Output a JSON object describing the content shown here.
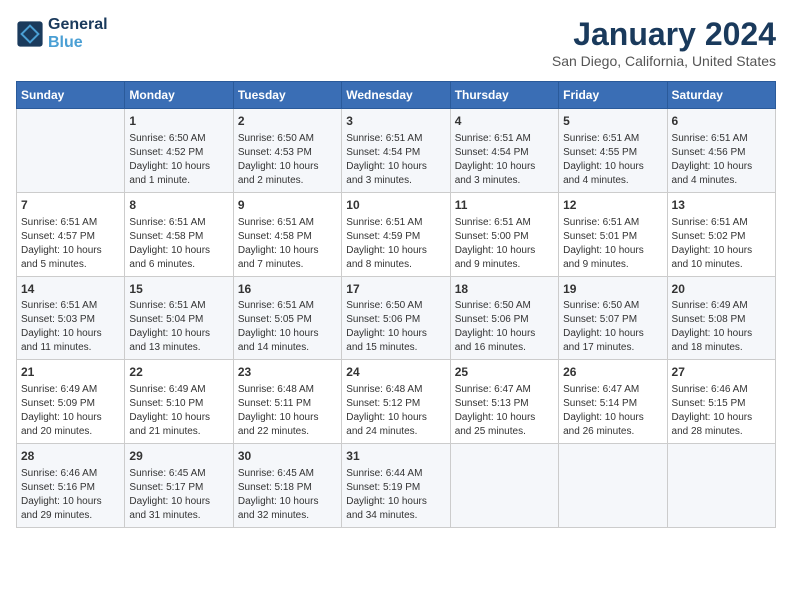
{
  "header": {
    "logo_line1": "General",
    "logo_line2": "Blue",
    "month_title": "January 2024",
    "subtitle": "San Diego, California, United States"
  },
  "calendar": {
    "days_of_week": [
      "Sunday",
      "Monday",
      "Tuesday",
      "Wednesday",
      "Thursday",
      "Friday",
      "Saturday"
    ],
    "weeks": [
      [
        {
          "day": "",
          "info": ""
        },
        {
          "day": "1",
          "info": "Sunrise: 6:50 AM\nSunset: 4:52 PM\nDaylight: 10 hours\nand 1 minute."
        },
        {
          "day": "2",
          "info": "Sunrise: 6:50 AM\nSunset: 4:53 PM\nDaylight: 10 hours\nand 2 minutes."
        },
        {
          "day": "3",
          "info": "Sunrise: 6:51 AM\nSunset: 4:54 PM\nDaylight: 10 hours\nand 3 minutes."
        },
        {
          "day": "4",
          "info": "Sunrise: 6:51 AM\nSunset: 4:54 PM\nDaylight: 10 hours\nand 3 minutes."
        },
        {
          "day": "5",
          "info": "Sunrise: 6:51 AM\nSunset: 4:55 PM\nDaylight: 10 hours\nand 4 minutes."
        },
        {
          "day": "6",
          "info": "Sunrise: 6:51 AM\nSunset: 4:56 PM\nDaylight: 10 hours\nand 4 minutes."
        }
      ],
      [
        {
          "day": "7",
          "info": "Sunrise: 6:51 AM\nSunset: 4:57 PM\nDaylight: 10 hours\nand 5 minutes."
        },
        {
          "day": "8",
          "info": "Sunrise: 6:51 AM\nSunset: 4:58 PM\nDaylight: 10 hours\nand 6 minutes."
        },
        {
          "day": "9",
          "info": "Sunrise: 6:51 AM\nSunset: 4:58 PM\nDaylight: 10 hours\nand 7 minutes."
        },
        {
          "day": "10",
          "info": "Sunrise: 6:51 AM\nSunset: 4:59 PM\nDaylight: 10 hours\nand 8 minutes."
        },
        {
          "day": "11",
          "info": "Sunrise: 6:51 AM\nSunset: 5:00 PM\nDaylight: 10 hours\nand 9 minutes."
        },
        {
          "day": "12",
          "info": "Sunrise: 6:51 AM\nSunset: 5:01 PM\nDaylight: 10 hours\nand 9 minutes."
        },
        {
          "day": "13",
          "info": "Sunrise: 6:51 AM\nSunset: 5:02 PM\nDaylight: 10 hours\nand 10 minutes."
        }
      ],
      [
        {
          "day": "14",
          "info": "Sunrise: 6:51 AM\nSunset: 5:03 PM\nDaylight: 10 hours\nand 11 minutes."
        },
        {
          "day": "15",
          "info": "Sunrise: 6:51 AM\nSunset: 5:04 PM\nDaylight: 10 hours\nand 13 minutes."
        },
        {
          "day": "16",
          "info": "Sunrise: 6:51 AM\nSunset: 5:05 PM\nDaylight: 10 hours\nand 14 minutes."
        },
        {
          "day": "17",
          "info": "Sunrise: 6:50 AM\nSunset: 5:06 PM\nDaylight: 10 hours\nand 15 minutes."
        },
        {
          "day": "18",
          "info": "Sunrise: 6:50 AM\nSunset: 5:06 PM\nDaylight: 10 hours\nand 16 minutes."
        },
        {
          "day": "19",
          "info": "Sunrise: 6:50 AM\nSunset: 5:07 PM\nDaylight: 10 hours\nand 17 minutes."
        },
        {
          "day": "20",
          "info": "Sunrise: 6:49 AM\nSunset: 5:08 PM\nDaylight: 10 hours\nand 18 minutes."
        }
      ],
      [
        {
          "day": "21",
          "info": "Sunrise: 6:49 AM\nSunset: 5:09 PM\nDaylight: 10 hours\nand 20 minutes."
        },
        {
          "day": "22",
          "info": "Sunrise: 6:49 AM\nSunset: 5:10 PM\nDaylight: 10 hours\nand 21 minutes."
        },
        {
          "day": "23",
          "info": "Sunrise: 6:48 AM\nSunset: 5:11 PM\nDaylight: 10 hours\nand 22 minutes."
        },
        {
          "day": "24",
          "info": "Sunrise: 6:48 AM\nSunset: 5:12 PM\nDaylight: 10 hours\nand 24 minutes."
        },
        {
          "day": "25",
          "info": "Sunrise: 6:47 AM\nSunset: 5:13 PM\nDaylight: 10 hours\nand 25 minutes."
        },
        {
          "day": "26",
          "info": "Sunrise: 6:47 AM\nSunset: 5:14 PM\nDaylight: 10 hours\nand 26 minutes."
        },
        {
          "day": "27",
          "info": "Sunrise: 6:46 AM\nSunset: 5:15 PM\nDaylight: 10 hours\nand 28 minutes."
        }
      ],
      [
        {
          "day": "28",
          "info": "Sunrise: 6:46 AM\nSunset: 5:16 PM\nDaylight: 10 hours\nand 29 minutes."
        },
        {
          "day": "29",
          "info": "Sunrise: 6:45 AM\nSunset: 5:17 PM\nDaylight: 10 hours\nand 31 minutes."
        },
        {
          "day": "30",
          "info": "Sunrise: 6:45 AM\nSunset: 5:18 PM\nDaylight: 10 hours\nand 32 minutes."
        },
        {
          "day": "31",
          "info": "Sunrise: 6:44 AM\nSunset: 5:19 PM\nDaylight: 10 hours\nand 34 minutes."
        },
        {
          "day": "",
          "info": ""
        },
        {
          "day": "",
          "info": ""
        },
        {
          "day": "",
          "info": ""
        }
      ]
    ]
  }
}
